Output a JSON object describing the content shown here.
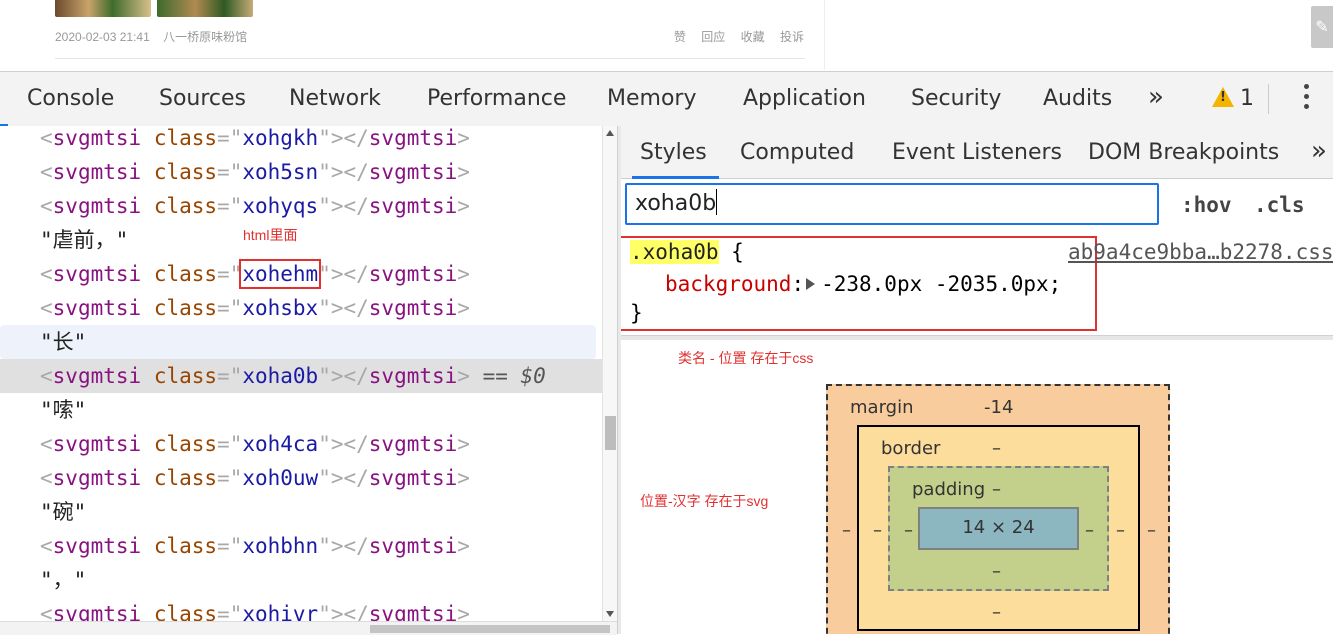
{
  "page": {
    "post_date": "2020-02-03 21:41",
    "post_place": "八一桥原味粉馆",
    "actions": [
      "赞",
      "回应",
      "收藏",
      "投诉"
    ]
  },
  "devtools": {
    "tabs": [
      "Console",
      "Sources",
      "Network",
      "Performance",
      "Memory",
      "Application",
      "Security",
      "Audits"
    ],
    "more": "»",
    "warning_count": "1"
  },
  "elements": {
    "tag": "svgmtsi",
    "attr": "class",
    "rows": [
      {
        "type": "tag",
        "value": "xohgkh"
      },
      {
        "type": "tag",
        "value": "xoh5sn"
      },
      {
        "type": "tag",
        "value": "xohyqs"
      },
      {
        "type": "text",
        "value": "\"虐前，\""
      },
      {
        "type": "tag",
        "value": "xohehm"
      },
      {
        "type": "tag",
        "value": "xohsbx"
      },
      {
        "type": "text",
        "value": "\"长\""
      },
      {
        "type": "tag",
        "value": "xoha0b"
      },
      {
        "type": "text",
        "value": "\"嗦\""
      },
      {
        "type": "tag",
        "value": "xoh4ca"
      },
      {
        "type": "tag",
        "value": "xoh0uw"
      },
      {
        "type": "text",
        "value": "\"碗\""
      },
      {
        "type": "tag",
        "value": "xohbhn"
      },
      {
        "type": "text",
        "value": "\"，\""
      },
      {
        "type": "tag",
        "value": "xohivr"
      }
    ],
    "selected_suffix": "== $0"
  },
  "annotations": {
    "html_note": "html里面",
    "css_note": "类名 - 位置 存在于css",
    "svg_note": "位置-汉字 存在于svg"
  },
  "styles": {
    "tabs": [
      "Styles",
      "Computed",
      "Event Listeners",
      "DOM Breakpoints"
    ],
    "more": "»",
    "filter_value": "xoha0b",
    "hov": ":hov",
    "cls": ".cls",
    "selector": ".xoha0b",
    "open_brace": " {",
    "close_brace": "}",
    "property": "background",
    "value": "-238.0px -2035.0px;",
    "source": "ab9a4ce9bba…b2278.css"
  },
  "box_model": {
    "margin_label": "margin",
    "margin_top": "-14",
    "border_label": "border",
    "border_top": "–",
    "padding_label": "padding",
    "padding_top": "–",
    "content": "14 × 24",
    "dash": "–"
  },
  "colors": {
    "accent": "#1a73e8",
    "annotation_red": "#e03131",
    "tag": "#881280",
    "attr_name": "#994500",
    "attr_value": "#1a1aa6"
  }
}
